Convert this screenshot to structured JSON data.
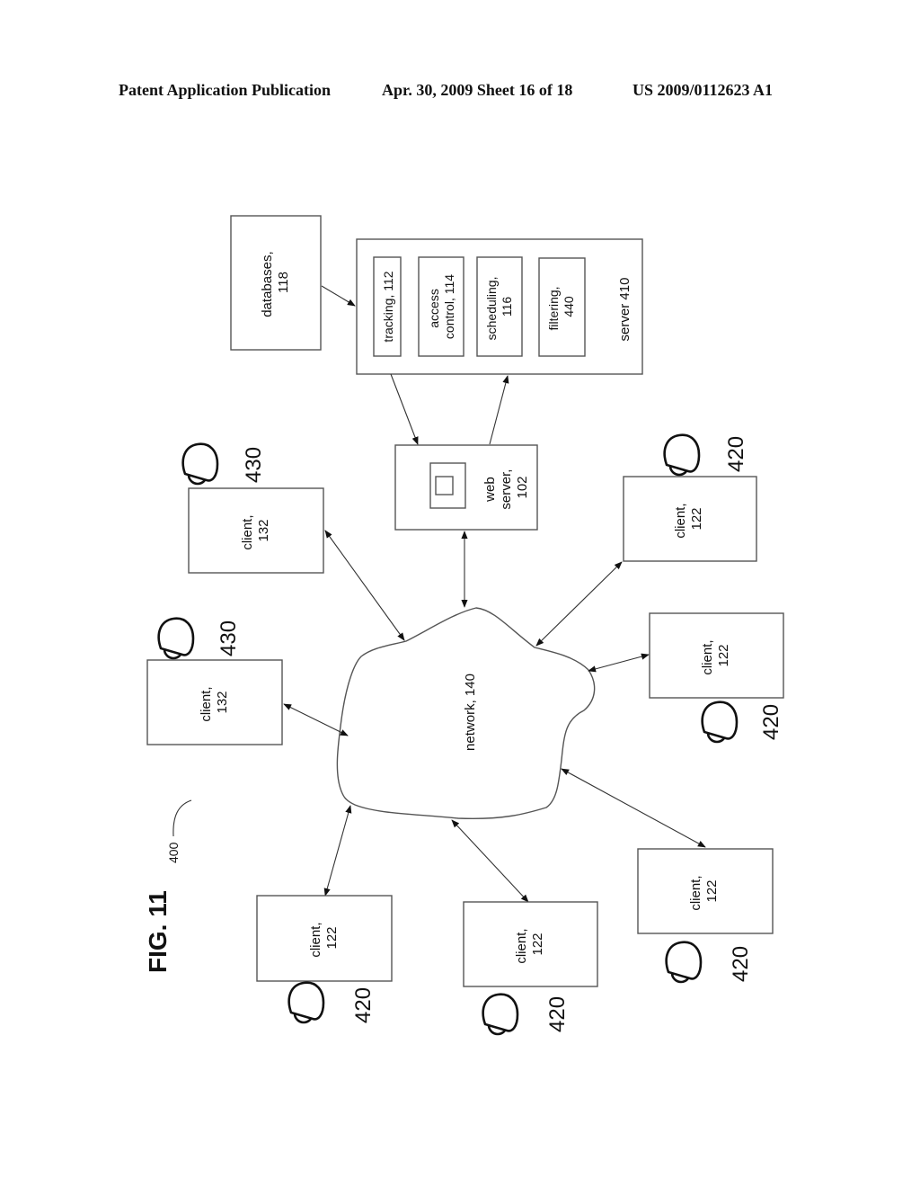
{
  "header": {
    "publication": "Patent Application Publication",
    "date_sheet": "Apr. 30, 2009  Sheet 16 of 18",
    "number": "US 2009/0112623 A1"
  },
  "figure": {
    "label": "FIG. 11",
    "ref": "400"
  },
  "nodes": {
    "databases": [
      "databases,",
      "118"
    ],
    "server": {
      "label": "server 410",
      "modules": [
        [
          "tracking, 112"
        ],
        [
          "access",
          "control, 114"
        ],
        [
          "scheduling,",
          "116"
        ],
        [
          "filtering,",
          "440"
        ]
      ]
    },
    "web_server": [
      "web",
      "server,",
      "102"
    ],
    "network": "network, 140",
    "clients": [
      {
        "lines": [
          "client,",
          "132"
        ],
        "user": "430"
      },
      {
        "lines": [
          "client,",
          "132"
        ],
        "user": "430"
      },
      {
        "lines": [
          "client,",
          "122"
        ],
        "user": "420"
      },
      {
        "lines": [
          "client,",
          "122"
        ],
        "user": "420"
      },
      {
        "lines": [
          "client,",
          "122"
        ],
        "user": "420"
      },
      {
        "lines": [
          "client,",
          "122"
        ],
        "user": "420"
      },
      {
        "lines": [
          "client,",
          "122"
        ],
        "user": "420"
      }
    ]
  }
}
